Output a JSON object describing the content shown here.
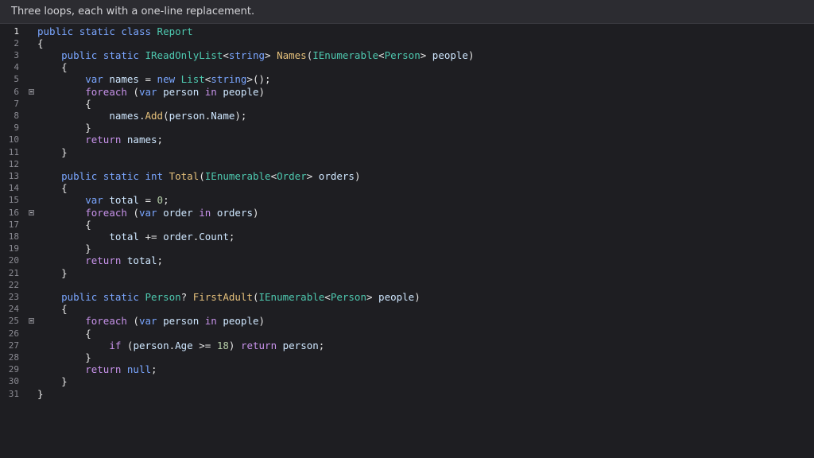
{
  "window": {
    "title": "Three loops, each with a one-line replacement."
  },
  "editor": {
    "active_line": 1,
    "lines": [
      {
        "n": "1",
        "fold": false,
        "tokens": [
          [
            "kw",
            "public"
          ],
          [
            "pn",
            " "
          ],
          [
            "kw",
            "static"
          ],
          [
            "pn",
            " "
          ],
          [
            "kw",
            "class"
          ],
          [
            "pn",
            " "
          ],
          [
            "ty",
            "Report"
          ]
        ]
      },
      {
        "n": "2",
        "fold": false,
        "tokens": [
          [
            "pn",
            "{"
          ]
        ]
      },
      {
        "n": "3",
        "fold": false,
        "tokens": [
          [
            "pn",
            "    "
          ],
          [
            "kw",
            "public"
          ],
          [
            "pn",
            " "
          ],
          [
            "kw",
            "static"
          ],
          [
            "pn",
            " "
          ],
          [
            "ty",
            "IReadOnlyList"
          ],
          [
            "pn",
            "<"
          ],
          [
            "kw",
            "string"
          ],
          [
            "pn",
            "> "
          ],
          [
            "fn",
            "Names"
          ],
          [
            "pn",
            "("
          ],
          [
            "ty",
            "IEnumerable"
          ],
          [
            "pn",
            "<"
          ],
          [
            "ty",
            "Person"
          ],
          [
            "pn",
            "> "
          ],
          [
            "id",
            "people"
          ],
          [
            "pn",
            ")"
          ]
        ]
      },
      {
        "n": "4",
        "fold": false,
        "tokens": [
          [
            "pn",
            "    {"
          ]
        ]
      },
      {
        "n": "5",
        "fold": false,
        "tokens": [
          [
            "pn",
            "        "
          ],
          [
            "kw",
            "var"
          ],
          [
            "pn",
            " "
          ],
          [
            "id",
            "names"
          ],
          [
            "pn",
            " = "
          ],
          [
            "kw",
            "new"
          ],
          [
            "pn",
            " "
          ],
          [
            "ty",
            "List"
          ],
          [
            "pn",
            "<"
          ],
          [
            "kw",
            "string"
          ],
          [
            "pn",
            ">();"
          ]
        ]
      },
      {
        "n": "6",
        "fold": true,
        "tokens": [
          [
            "pn",
            "        "
          ],
          [
            "kwr",
            "foreach"
          ],
          [
            "pn",
            " ("
          ],
          [
            "kw",
            "var"
          ],
          [
            "pn",
            " "
          ],
          [
            "id",
            "person"
          ],
          [
            "pn",
            " "
          ],
          [
            "kwr",
            "in"
          ],
          [
            "pn",
            " "
          ],
          [
            "id",
            "people"
          ],
          [
            "pn",
            ")"
          ]
        ]
      },
      {
        "n": "7",
        "fold": false,
        "tokens": [
          [
            "pn",
            "        {"
          ]
        ]
      },
      {
        "n": "8",
        "fold": false,
        "tokens": [
          [
            "pn",
            "            "
          ],
          [
            "id",
            "names"
          ],
          [
            "pn",
            "."
          ],
          [
            "fn",
            "Add"
          ],
          [
            "pn",
            "("
          ],
          [
            "id",
            "person"
          ],
          [
            "pn",
            "."
          ],
          [
            "id",
            "Name"
          ],
          [
            "pn",
            ");"
          ]
        ]
      },
      {
        "n": "9",
        "fold": false,
        "tokens": [
          [
            "pn",
            "        }"
          ]
        ]
      },
      {
        "n": "10",
        "fold": false,
        "tokens": [
          [
            "pn",
            "        "
          ],
          [
            "kwr",
            "return"
          ],
          [
            "pn",
            " "
          ],
          [
            "id",
            "names"
          ],
          [
            "pn",
            ";"
          ]
        ]
      },
      {
        "n": "11",
        "fold": false,
        "tokens": [
          [
            "pn",
            "    }"
          ]
        ]
      },
      {
        "n": "12",
        "fold": false,
        "tokens": []
      },
      {
        "n": "13",
        "fold": false,
        "tokens": [
          [
            "pn",
            "    "
          ],
          [
            "kw",
            "public"
          ],
          [
            "pn",
            " "
          ],
          [
            "kw",
            "static"
          ],
          [
            "pn",
            " "
          ],
          [
            "kw",
            "int"
          ],
          [
            "pn",
            " "
          ],
          [
            "fn",
            "Total"
          ],
          [
            "pn",
            "("
          ],
          [
            "ty",
            "IEnumerable"
          ],
          [
            "pn",
            "<"
          ],
          [
            "ty",
            "Order"
          ],
          [
            "pn",
            "> "
          ],
          [
            "id",
            "orders"
          ],
          [
            "pn",
            ")"
          ]
        ]
      },
      {
        "n": "14",
        "fold": false,
        "tokens": [
          [
            "pn",
            "    {"
          ]
        ]
      },
      {
        "n": "15",
        "fold": false,
        "tokens": [
          [
            "pn",
            "        "
          ],
          [
            "kw",
            "var"
          ],
          [
            "pn",
            " "
          ],
          [
            "id",
            "total"
          ],
          [
            "pn",
            " = "
          ],
          [
            "nm",
            "0"
          ],
          [
            "pn",
            ";"
          ]
        ]
      },
      {
        "n": "16",
        "fold": true,
        "tokens": [
          [
            "pn",
            "        "
          ],
          [
            "kwr",
            "foreach"
          ],
          [
            "pn",
            " ("
          ],
          [
            "kw",
            "var"
          ],
          [
            "pn",
            " "
          ],
          [
            "id",
            "order"
          ],
          [
            "pn",
            " "
          ],
          [
            "kwr",
            "in"
          ],
          [
            "pn",
            " "
          ],
          [
            "id",
            "orders"
          ],
          [
            "pn",
            ")"
          ]
        ]
      },
      {
        "n": "17",
        "fold": false,
        "tokens": [
          [
            "pn",
            "        {"
          ]
        ]
      },
      {
        "n": "18",
        "fold": false,
        "tokens": [
          [
            "pn",
            "            "
          ],
          [
            "id",
            "total"
          ],
          [
            "pn",
            " += "
          ],
          [
            "id",
            "order"
          ],
          [
            "pn",
            "."
          ],
          [
            "id",
            "Count"
          ],
          [
            "pn",
            ";"
          ]
        ]
      },
      {
        "n": "19",
        "fold": false,
        "tokens": [
          [
            "pn",
            "        }"
          ]
        ]
      },
      {
        "n": "20",
        "fold": false,
        "tokens": [
          [
            "pn",
            "        "
          ],
          [
            "kwr",
            "return"
          ],
          [
            "pn",
            " "
          ],
          [
            "id",
            "total"
          ],
          [
            "pn",
            ";"
          ]
        ]
      },
      {
        "n": "21",
        "fold": false,
        "tokens": [
          [
            "pn",
            "    }"
          ]
        ]
      },
      {
        "n": "22",
        "fold": false,
        "tokens": []
      },
      {
        "n": "23",
        "fold": false,
        "tokens": [
          [
            "pn",
            "    "
          ],
          [
            "kw",
            "public"
          ],
          [
            "pn",
            " "
          ],
          [
            "kw",
            "static"
          ],
          [
            "pn",
            " "
          ],
          [
            "ty",
            "Person"
          ],
          [
            "pn",
            "? "
          ],
          [
            "fn",
            "FirstAdult"
          ],
          [
            "pn",
            "("
          ],
          [
            "ty",
            "IEnumerable"
          ],
          [
            "pn",
            "<"
          ],
          [
            "ty",
            "Person"
          ],
          [
            "pn",
            "> "
          ],
          [
            "id",
            "people"
          ],
          [
            "pn",
            ")"
          ]
        ]
      },
      {
        "n": "24",
        "fold": false,
        "tokens": [
          [
            "pn",
            "    {"
          ]
        ]
      },
      {
        "n": "25",
        "fold": true,
        "tokens": [
          [
            "pn",
            "        "
          ],
          [
            "kwr",
            "foreach"
          ],
          [
            "pn",
            " ("
          ],
          [
            "kw",
            "var"
          ],
          [
            "pn",
            " "
          ],
          [
            "id",
            "person"
          ],
          [
            "pn",
            " "
          ],
          [
            "kwr",
            "in"
          ],
          [
            "pn",
            " "
          ],
          [
            "id",
            "people"
          ],
          [
            "pn",
            ")"
          ]
        ]
      },
      {
        "n": "26",
        "fold": false,
        "tokens": [
          [
            "pn",
            "        {"
          ]
        ]
      },
      {
        "n": "27",
        "fold": false,
        "tokens": [
          [
            "pn",
            "            "
          ],
          [
            "kwr",
            "if"
          ],
          [
            "pn",
            " ("
          ],
          [
            "id",
            "person"
          ],
          [
            "pn",
            "."
          ],
          [
            "id",
            "Age"
          ],
          [
            "pn",
            " >= "
          ],
          [
            "nm",
            "18"
          ],
          [
            "pn",
            ") "
          ],
          [
            "kwr",
            "return"
          ],
          [
            "pn",
            " "
          ],
          [
            "id",
            "person"
          ],
          [
            "pn",
            ";"
          ]
        ]
      },
      {
        "n": "28",
        "fold": false,
        "tokens": [
          [
            "pn",
            "        }"
          ]
        ]
      },
      {
        "n": "29",
        "fold": false,
        "tokens": [
          [
            "pn",
            "        "
          ],
          [
            "kwr",
            "return"
          ],
          [
            "pn",
            " "
          ],
          [
            "kw",
            "null"
          ],
          [
            "pn",
            ";"
          ]
        ]
      },
      {
        "n": "30",
        "fold": false,
        "tokens": [
          [
            "pn",
            "    }"
          ]
        ]
      },
      {
        "n": "31",
        "fold": false,
        "tokens": [
          [
            "pn",
            "}"
          ]
        ]
      }
    ]
  }
}
